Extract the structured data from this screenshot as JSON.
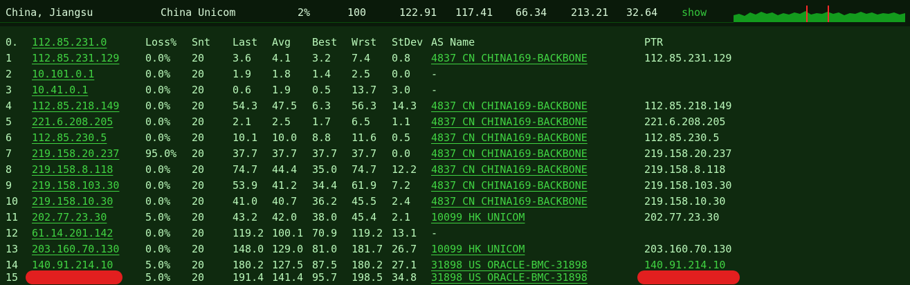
{
  "header": {
    "location": "China, Jiangsu",
    "isp": "China Unicom",
    "loss": "2%",
    "sent": "100",
    "last": "122.91",
    "avg": "117.41",
    "best": "66.34",
    "worst": "213.21",
    "stdev": "32.64",
    "show_label": "show"
  },
  "table": {
    "columns": [
      "0.",
      "112.85.231.0",
      "Loss%",
      "Snt",
      "Last",
      "Avg",
      "Best",
      "Wrst",
      "StDev",
      "AS Name",
      "PTR"
    ],
    "rows": [
      {
        "hop": "1",
        "ip": "112.85.231.129",
        "loss": "0.0%",
        "snt": "20",
        "last": "3.6",
        "avg": "4.1",
        "best": "3.2",
        "wrst": "7.4",
        "stdev": "0.8",
        "as_name": "4837  CN CHINA169-BACKBONE",
        "ptr": "112.85.231.129"
      },
      {
        "hop": "2",
        "ip": "10.101.0.1",
        "loss": "0.0%",
        "snt": "20",
        "last": "1.9",
        "avg": "1.8",
        "best": "1.4",
        "wrst": "2.5",
        "stdev": "0.0",
        "as_name": "-",
        "ptr": ""
      },
      {
        "hop": "3",
        "ip": "10.41.0.1",
        "loss": "0.0%",
        "snt": "20",
        "last": "0.6",
        "avg": "1.9",
        "best": "0.5",
        "wrst": "13.7",
        "stdev": "3.0",
        "as_name": "-",
        "ptr": ""
      },
      {
        "hop": "4",
        "ip": "112.85.218.149",
        "loss": "0.0%",
        "snt": "20",
        "last": "54.3",
        "avg": "47.5",
        "best": "6.3",
        "wrst": "56.3",
        "stdev": "14.3",
        "as_name": "4837  CN CHINA169-BACKBONE",
        "ptr": "112.85.218.149"
      },
      {
        "hop": "5",
        "ip": "221.6.208.205",
        "loss": "0.0%",
        "snt": "20",
        "last": "2.1",
        "avg": "2.5",
        "best": "1.7",
        "wrst": "6.5",
        "stdev": "1.1",
        "as_name": "4837  CN CHINA169-BACKBONE",
        "ptr": "221.6.208.205"
      },
      {
        "hop": "6",
        "ip": "112.85.230.5",
        "loss": "0.0%",
        "snt": "20",
        "last": "10.1",
        "avg": "10.0",
        "best": "8.8",
        "wrst": "11.6",
        "stdev": "0.5",
        "as_name": "4837  CN CHINA169-BACKBONE",
        "ptr": "112.85.230.5"
      },
      {
        "hop": "7",
        "ip": "219.158.20.237",
        "loss": "95.0%",
        "snt": "20",
        "last": "37.7",
        "avg": "37.7",
        "best": "37.7",
        "wrst": "37.7",
        "stdev": "0.0",
        "as_name": "4837  CN CHINA169-BACKBONE",
        "ptr": "219.158.20.237"
      },
      {
        "hop": "8",
        "ip": "219.158.8.118",
        "loss": "0.0%",
        "snt": "20",
        "last": "74.7",
        "avg": "44.4",
        "best": "35.0",
        "wrst": "74.7",
        "stdev": "12.2",
        "as_name": "4837  CN CHINA169-BACKBONE",
        "ptr": "219.158.8.118"
      },
      {
        "hop": "9",
        "ip": "219.158.103.30",
        "loss": "0.0%",
        "snt": "20",
        "last": "53.9",
        "avg": "41.2",
        "best": "34.4",
        "wrst": "61.9",
        "stdev": "7.2",
        "as_name": "4837  CN CHINA169-BACKBONE",
        "ptr": "219.158.103.30"
      },
      {
        "hop": "10",
        "ip": "219.158.10.30",
        "loss": "0.0%",
        "snt": "20",
        "last": "41.0",
        "avg": "40.7",
        "best": "36.2",
        "wrst": "45.5",
        "stdev": "2.4",
        "as_name": "4837  CN CHINA169-BACKBONE",
        "ptr": "219.158.10.30"
      },
      {
        "hop": "11",
        "ip": "202.77.23.30",
        "loss": "5.0%",
        "snt": "20",
        "last": "43.2",
        "avg": "42.0",
        "best": "38.0",
        "wrst": "45.4",
        "stdev": "2.1",
        "as_name": "10099 HK UNICOM",
        "ptr": "202.77.23.30"
      },
      {
        "hop": "12",
        "ip": "61.14.201.142",
        "loss": "0.0%",
        "snt": "20",
        "last": "119.2",
        "avg": "100.1",
        "best": "70.9",
        "wrst": "119.2",
        "stdev": "13.1",
        "as_name": "-",
        "ptr": ""
      },
      {
        "hop": "13",
        "ip": "203.160.70.130",
        "loss": "0.0%",
        "snt": "20",
        "last": "148.0",
        "avg": "129.0",
        "best": "81.0",
        "wrst": "181.7",
        "stdev": "26.7",
        "as_name": "10099 HK UNICOM",
        "ptr": "203.160.70.130"
      },
      {
        "hop": "14",
        "ip": "140.91.214.10",
        "loss": "5.0%",
        "snt": "20",
        "last": "180.2",
        "avg": "127.5",
        "best": "87.5",
        "wrst": "180.2",
        "stdev": "27.1",
        "as_name": "31898 US ORACLE-BMC-31898",
        "ptr": "140.91.214.10"
      },
      {
        "hop": "15",
        "ip": "",
        "loss": "5.0%",
        "snt": "20",
        "last": "191.4",
        "avg": "141.4",
        "best": "95.7",
        "wrst": "198.5",
        "stdev": "34.8",
        "as_name": "31898 US ORACLE-BMC-31898",
        "ptr": "",
        "ip_redacted": true,
        "ptr_redacted": true
      }
    ]
  },
  "colors": {
    "background": "#0f2a0f",
    "header_bg": "#0a1a0a",
    "text": "#b9f7b9",
    "link": "#40d342",
    "redaction": "#e21f1f",
    "graph_green": "#139b1d",
    "graph_red": "#ff2a2a"
  }
}
